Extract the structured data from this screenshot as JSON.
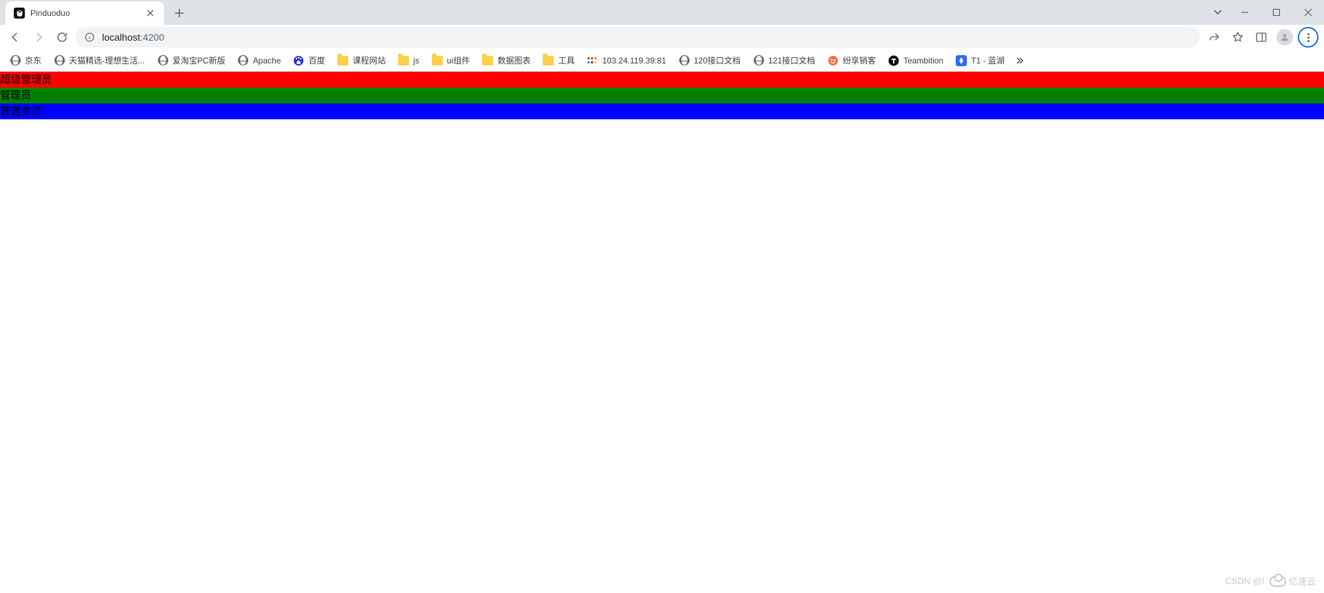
{
  "tab": {
    "title": "Pinduoduo"
  },
  "nav": {
    "url_host": "localhost",
    "url_port": ":4200"
  },
  "bookmarks": [
    {
      "type": "globe",
      "label": "京东"
    },
    {
      "type": "globe",
      "label": "天猫精选-理想生活..."
    },
    {
      "type": "globe",
      "label": "爱淘宝PC新版"
    },
    {
      "type": "globe",
      "label": "Apache"
    },
    {
      "type": "baidu",
      "label": "百度"
    },
    {
      "type": "folder",
      "label": "课程网站"
    },
    {
      "type": "folder",
      "label": "js"
    },
    {
      "type": "folder",
      "label": "ui组件"
    },
    {
      "type": "folder",
      "label": "数据图表"
    },
    {
      "type": "folder",
      "label": "工具"
    },
    {
      "type": "img",
      "label": "103.24.119.39:81"
    },
    {
      "type": "globe",
      "label": "120接口文档"
    },
    {
      "type": "globe",
      "label": "121接口文档"
    },
    {
      "type": "img2",
      "label": "纷享销客"
    },
    {
      "type": "tb",
      "label": "Teambition"
    },
    {
      "type": "lanhu",
      "label": "T1 - 蓝湖"
    }
  ],
  "page_bands": [
    {
      "color": "red",
      "label": "超级管理员"
    },
    {
      "color": "green",
      "label": "管理员"
    },
    {
      "color": "blue",
      "label": "普通会员"
    }
  ],
  "watermark": {
    "left": "CSDN @l",
    "right": "亿速云"
  }
}
